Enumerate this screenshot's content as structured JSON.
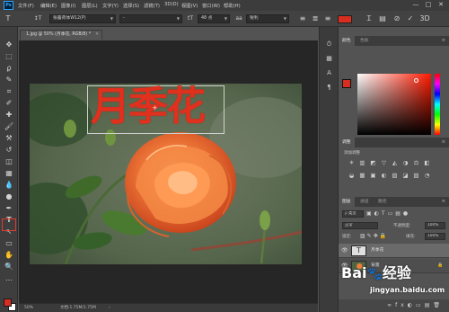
{
  "colors": {
    "accent_red": "#d92d1f",
    "highlight": "#e23a2b",
    "photoshop_blue": "#31a8ff"
  },
  "menubar": {
    "logo": "Ps",
    "items": [
      "文件(F)",
      "编辑(E)",
      "图像(I)",
      "图层(L)",
      "文字(Y)",
      "选择(S)",
      "滤镜(T)",
      "3D(D)",
      "视图(V)",
      "窗口(W)",
      "帮助(H)"
    ],
    "window_buttons": [
      "—",
      "□",
      "✕"
    ]
  },
  "options_bar": {
    "tool_icon": "type-tool-icon",
    "font_family": "张露荷体W12(P)",
    "font_style": "-",
    "font_size": "48 点",
    "antialias": "锐利",
    "text_color": "#d92d1f"
  },
  "document": {
    "tab_title": "1.jpg @ 50% (月季花, RGB/8) *",
    "text_layer_content": "月季花",
    "zoom": "50%",
    "status": "文档:1.75M/1.75M"
  },
  "tools": [
    "move-tool",
    "marquee-tool",
    "lasso-tool",
    "quick-select-tool",
    "crop-tool",
    "eyedropper-tool",
    "healing-tool",
    "brush-tool",
    "clone-stamp-tool",
    "history-brush-tool",
    "eraser-tool",
    "gradient-tool",
    "blur-tool",
    "dodge-tool",
    "pen-tool",
    "type-tool",
    "path-select-tool",
    "rectangle-tool",
    "hand-tool",
    "zoom-tool",
    "more-tools"
  ],
  "tool_glyphs": [
    "✥",
    "⬚",
    "ϼ",
    "✎",
    "⌗",
    "✐",
    "✚",
    "🖌",
    "⚒",
    "↺",
    "◫",
    "▦",
    "💧",
    "●",
    "✒",
    "T",
    "↖",
    "▭",
    "✋",
    "🔍",
    "…"
  ],
  "panels": {
    "color": {
      "tabs": [
        "颜色",
        "色板"
      ],
      "fg": "#d92d1f",
      "bg": "#ffffff"
    },
    "adjustments": {
      "tab": "调整",
      "title": "添加调整"
    },
    "layers": {
      "tabs": [
        "图层",
        "通道",
        "路径"
      ],
      "filter_kind": "类型",
      "blend_mode": "正常",
      "opacity_label": "不透明度:",
      "opacity_value": "100%",
      "lock_label": "锁定:",
      "fill_label": "填充:",
      "fill_value": "100%",
      "items": [
        {
          "name": "月季花",
          "type": "text",
          "selected": true
        },
        {
          "name": "背景",
          "type": "image",
          "selected": false
        }
      ]
    }
  },
  "watermark": {
    "brand": "Bai",
    "brand2": "经验",
    "url": "jingyan.baidu.com"
  }
}
